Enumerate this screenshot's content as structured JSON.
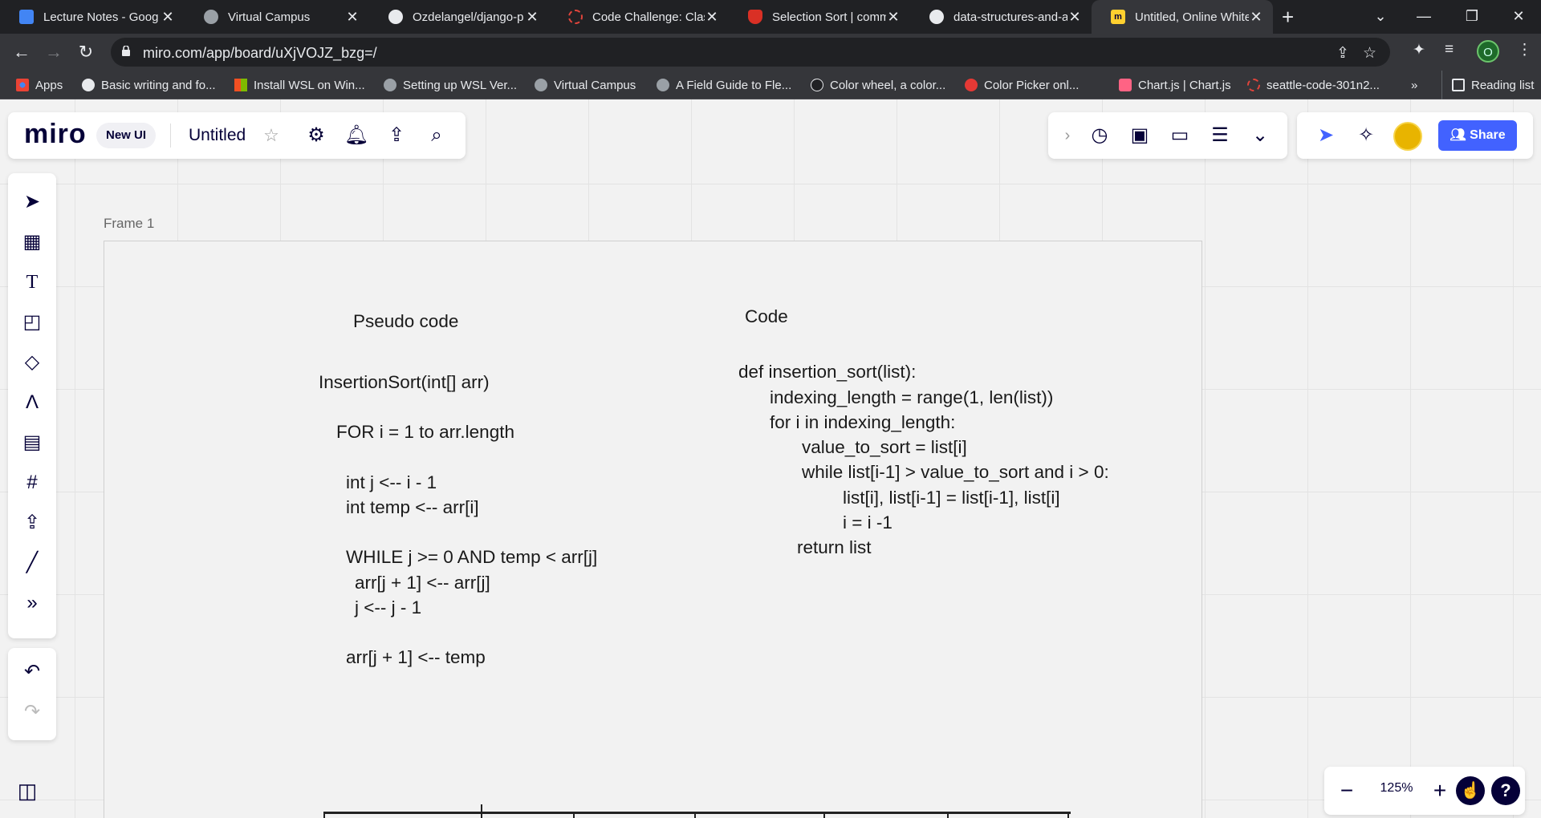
{
  "browser": {
    "tabs": [
      {
        "title": "Lecture Notes - Goog",
        "fav_color": "#4285f4",
        "icon": "docs-icon"
      },
      {
        "title": "Virtual Campus",
        "fav_color": "#9aa0a6",
        "icon": "globe-icon"
      },
      {
        "title": "Ozdelangel/django-p",
        "fav_color": "#e8eaed",
        "icon": "github-icon"
      },
      {
        "title": "Code Challenge: Class",
        "fav_color": "#e0443b",
        "icon": "codefellows-icon"
      },
      {
        "title": "Selection Sort | comm",
        "fav_color": "#d93025",
        "icon": "shield-icon"
      },
      {
        "title": "data-structures-and-a",
        "fav_color": "#e8eaed",
        "icon": "github-icon"
      },
      {
        "title": "Untitled, Online White",
        "fav_color": "#ffd02f",
        "icon": "miro-icon",
        "active": true
      }
    ],
    "url": "miro.com/app/board/uXjVOJZ_bzg=/",
    "profile_letter": "O",
    "bookmarks": [
      {
        "label": "Apps",
        "color": "#4285f4"
      },
      {
        "label": "Basic writing and fo...",
        "color": "#e8eaed"
      },
      {
        "label": "Install WSL on Win...",
        "color": "#f25022"
      },
      {
        "label": "Setting up WSL Ver...",
        "color": "#9aa0a6"
      },
      {
        "label": "Virtual Campus",
        "color": "#9aa0a6"
      },
      {
        "label": "A Field Guide to Fle...",
        "color": "#9aa0a6"
      },
      {
        "label": "Color wheel, a color...",
        "color": "#202124"
      },
      {
        "label": "Color Picker onl...",
        "color": "#e53935"
      },
      {
        "label": "Chart.js | Chart.js",
        "color": "#ff6384"
      },
      {
        "label": "seattle-code-301n2...",
        "color": "#e0443b"
      }
    ],
    "more_bookmarks": "»",
    "reading_list": "Reading list"
  },
  "miro": {
    "logo": "miro",
    "new_ui": "New UI",
    "board_title": "Untitled",
    "share_label": "Share",
    "zoom": "125%",
    "frame_label": "Frame 1",
    "help": "?"
  },
  "canvas": {
    "pseudo_title": "Pseudo code",
    "pseudo_lines": [
      "InsertionSort(int[] arr)",
      "FOR i = 1 to arr.length",
      "int j <-- i - 1",
      "int temp <-- arr[i]",
      "WHILE j >= 0 AND temp < arr[j]",
      "arr[j + 1] <-- arr[j]",
      "j <-- j - 1",
      "arr[j + 1] <-- temp"
    ],
    "code_title": "Code",
    "code_lines": [
      "def insertion_sort(list):",
      "indexing_length = range(1, len(list))",
      "for i in indexing_length:",
      "value_to_sort = list[i]",
      "while list[i-1] > value_to_sort and i > 0:",
      "list[i], list[i-1] = list[i-1], list[i]",
      "i = i -1",
      "return list"
    ]
  }
}
